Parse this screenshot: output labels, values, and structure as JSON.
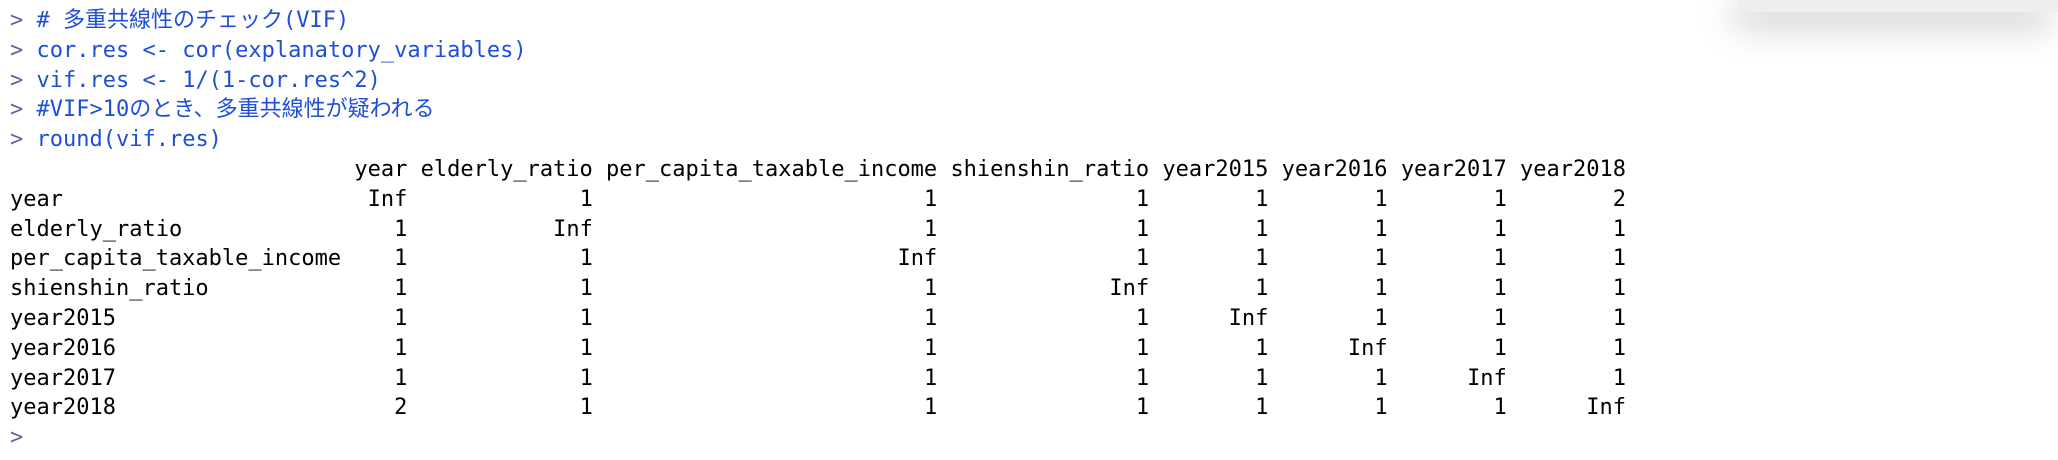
{
  "prompt_symbol": ">",
  "commands": [
    "# 多重共線性のチェック(VIF)",
    "cor.res <- cor(explanatory_variables)",
    "vif.res <- 1/(1-cor.res^2)",
    "#VIF>10のとき、多重共線性が疑われる",
    "round(vif.res)"
  ],
  "vif_table": {
    "columns": [
      "year",
      "elderly_ratio",
      "per_capita_taxable_income",
      "shienshin_ratio",
      "year2015",
      "year2016",
      "year2017",
      "year2018"
    ],
    "rows": [
      {
        "name": "year",
        "values": [
          "Inf",
          "1",
          "1",
          "1",
          "1",
          "1",
          "1",
          "2"
        ]
      },
      {
        "name": "elderly_ratio",
        "values": [
          "1",
          "Inf",
          "1",
          "1",
          "1",
          "1",
          "1",
          "1"
        ]
      },
      {
        "name": "per_capita_taxable_income",
        "values": [
          "1",
          "1",
          "Inf",
          "1",
          "1",
          "1",
          "1",
          "1"
        ]
      },
      {
        "name": "shienshin_ratio",
        "values": [
          "1",
          "1",
          "1",
          "Inf",
          "1",
          "1",
          "1",
          "1"
        ]
      },
      {
        "name": "year2015",
        "values": [
          "1",
          "1",
          "1",
          "1",
          "Inf",
          "1",
          "1",
          "1"
        ]
      },
      {
        "name": "year2016",
        "values": [
          "1",
          "1",
          "1",
          "1",
          "1",
          "Inf",
          "1",
          "1"
        ]
      },
      {
        "name": "year2017",
        "values": [
          "1",
          "1",
          "1",
          "1",
          "1",
          "1",
          "Inf",
          "1"
        ]
      },
      {
        "name": "year2018",
        "values": [
          "2",
          "1",
          "1",
          "1",
          "1",
          "1",
          "1",
          "Inf"
        ]
      }
    ]
  },
  "colors": {
    "prompt": "#6d5a9e",
    "input": "#1f4fd6",
    "output": "#000000"
  }
}
